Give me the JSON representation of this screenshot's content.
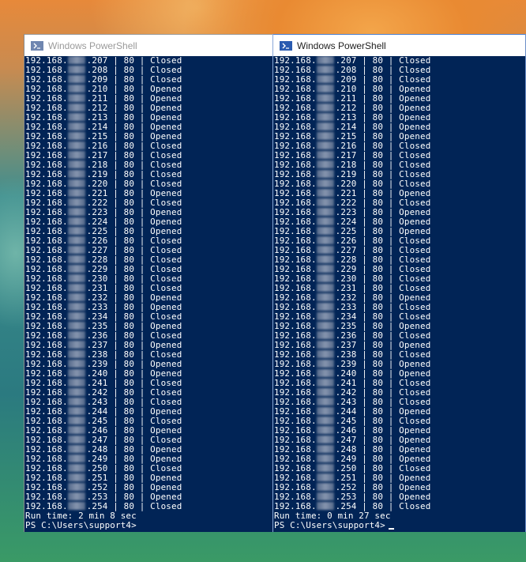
{
  "left_window": {
    "title": "Windows PowerShell",
    "ip_prefix": "192.168.",
    "port": "80",
    "results": [
      {
        "host": ".207",
        "status": "Closed"
      },
      {
        "host": ".208",
        "status": "Closed"
      },
      {
        "host": ".209",
        "status": "Closed"
      },
      {
        "host": ".210",
        "status": "Opened"
      },
      {
        "host": ".211",
        "status": "Opened"
      },
      {
        "host": ".212",
        "status": "Opened"
      },
      {
        "host": ".213",
        "status": "Opened"
      },
      {
        "host": ".214",
        "status": "Opened"
      },
      {
        "host": ".215",
        "status": "Opened"
      },
      {
        "host": ".216",
        "status": "Closed"
      },
      {
        "host": ".217",
        "status": "Closed"
      },
      {
        "host": ".218",
        "status": "Closed"
      },
      {
        "host": ".219",
        "status": "Closed"
      },
      {
        "host": ".220",
        "status": "Closed"
      },
      {
        "host": ".221",
        "status": "Opened"
      },
      {
        "host": ".222",
        "status": "Closed"
      },
      {
        "host": ".223",
        "status": "Opened"
      },
      {
        "host": ".224",
        "status": "Opened"
      },
      {
        "host": ".225",
        "status": "Opened"
      },
      {
        "host": ".226",
        "status": "Closed"
      },
      {
        "host": ".227",
        "status": "Closed"
      },
      {
        "host": ".228",
        "status": "Closed"
      },
      {
        "host": ".229",
        "status": "Closed"
      },
      {
        "host": ".230",
        "status": "Closed"
      },
      {
        "host": ".231",
        "status": "Closed"
      },
      {
        "host": ".232",
        "status": "Opened"
      },
      {
        "host": ".233",
        "status": "Opened"
      },
      {
        "host": ".234",
        "status": "Closed"
      },
      {
        "host": ".235",
        "status": "Opened"
      },
      {
        "host": ".236",
        "status": "Closed"
      },
      {
        "host": ".237",
        "status": "Opened"
      },
      {
        "host": ".238",
        "status": "Closed"
      },
      {
        "host": ".239",
        "status": "Opened"
      },
      {
        "host": ".240",
        "status": "Opened"
      },
      {
        "host": ".241",
        "status": "Closed"
      },
      {
        "host": ".242",
        "status": "Closed"
      },
      {
        "host": ".243",
        "status": "Closed"
      },
      {
        "host": ".244",
        "status": "Opened"
      },
      {
        "host": ".245",
        "status": "Closed"
      },
      {
        "host": ".246",
        "status": "Opened"
      },
      {
        "host": ".247",
        "status": "Closed"
      },
      {
        "host": ".248",
        "status": "Opened"
      },
      {
        "host": ".249",
        "status": "Opened"
      },
      {
        "host": ".250",
        "status": "Closed"
      },
      {
        "host": ".251",
        "status": "Opened"
      },
      {
        "host": ".252",
        "status": "Opened"
      },
      {
        "host": ".253",
        "status": "Opened"
      },
      {
        "host": ".254",
        "status": "Closed"
      }
    ],
    "run_time": "Run time: 2 min 8 sec",
    "prompt": "PS C:\\Users\\support4>"
  },
  "right_window": {
    "title": "Windows PowerShell",
    "ip_prefix": "192.168.",
    "port": "80",
    "results": [
      {
        "host": ".207",
        "status": "Closed"
      },
      {
        "host": ".208",
        "status": "Closed"
      },
      {
        "host": ".209",
        "status": "Closed"
      },
      {
        "host": ".210",
        "status": "Opened"
      },
      {
        "host": ".211",
        "status": "Opened"
      },
      {
        "host": ".212",
        "status": "Opened"
      },
      {
        "host": ".213",
        "status": "Opened"
      },
      {
        "host": ".214",
        "status": "Opened"
      },
      {
        "host": ".215",
        "status": "Opened"
      },
      {
        "host": ".216",
        "status": "Closed"
      },
      {
        "host": ".217",
        "status": "Closed"
      },
      {
        "host": ".218",
        "status": "Closed"
      },
      {
        "host": ".219",
        "status": "Closed"
      },
      {
        "host": ".220",
        "status": "Closed"
      },
      {
        "host": ".221",
        "status": "Opened"
      },
      {
        "host": ".222",
        "status": "Closed"
      },
      {
        "host": ".223",
        "status": "Opened"
      },
      {
        "host": ".224",
        "status": "Opened"
      },
      {
        "host": ".225",
        "status": "Opened"
      },
      {
        "host": ".226",
        "status": "Closed"
      },
      {
        "host": ".227",
        "status": "Closed"
      },
      {
        "host": ".228",
        "status": "Closed"
      },
      {
        "host": ".229",
        "status": "Closed"
      },
      {
        "host": ".230",
        "status": "Closed"
      },
      {
        "host": ".231",
        "status": "Closed"
      },
      {
        "host": ".232",
        "status": "Opened"
      },
      {
        "host": ".233",
        "status": "Closed"
      },
      {
        "host": ".234",
        "status": "Closed"
      },
      {
        "host": ".235",
        "status": "Opened"
      },
      {
        "host": ".236",
        "status": "Closed"
      },
      {
        "host": ".237",
        "status": "Opened"
      },
      {
        "host": ".238",
        "status": "Closed"
      },
      {
        "host": ".239",
        "status": "Opened"
      },
      {
        "host": ".240",
        "status": "Opened"
      },
      {
        "host": ".241",
        "status": "Closed"
      },
      {
        "host": ".242",
        "status": "Closed"
      },
      {
        "host": ".243",
        "status": "Closed"
      },
      {
        "host": ".244",
        "status": "Opened"
      },
      {
        "host": ".245",
        "status": "Closed"
      },
      {
        "host": ".246",
        "status": "Opened"
      },
      {
        "host": ".247",
        "status": "Opened"
      },
      {
        "host": ".248",
        "status": "Opened"
      },
      {
        "host": ".249",
        "status": "Opened"
      },
      {
        "host": ".250",
        "status": "Closed"
      },
      {
        "host": ".251",
        "status": "Opened"
      },
      {
        "host": ".252",
        "status": "Opened"
      },
      {
        "host": ".253",
        "status": "Opened"
      },
      {
        "host": ".254",
        "status": "Closed"
      }
    ],
    "run_time": "Run time: 0 min 27 sec",
    "prompt": "PS C:\\Users\\support4>"
  },
  "colors": {
    "console_background": "#012456",
    "console_text": "#ffffff"
  },
  "icons": [
    "powershell-icon"
  ]
}
